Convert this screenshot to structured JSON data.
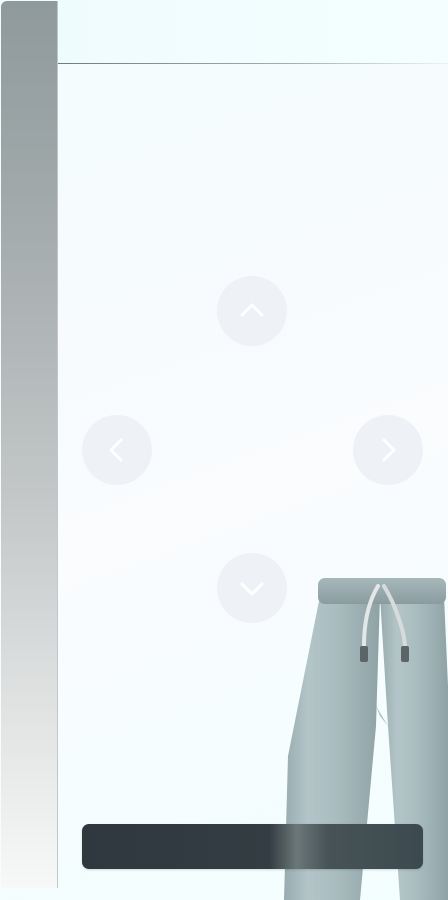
{
  "nav": {
    "up_icon": "chevron-up-icon",
    "left_icon": "chevron-left-icon",
    "right_icon": "chevron-right-icon",
    "down_icon": "chevron-down-icon",
    "button_color": "#eef1f6",
    "icon_color": "#ffffff"
  },
  "product": {
    "image": "sweatpants-icon",
    "color": "#a9bcbf"
  },
  "action_bar": {
    "label": "",
    "color": "#2f383f"
  }
}
